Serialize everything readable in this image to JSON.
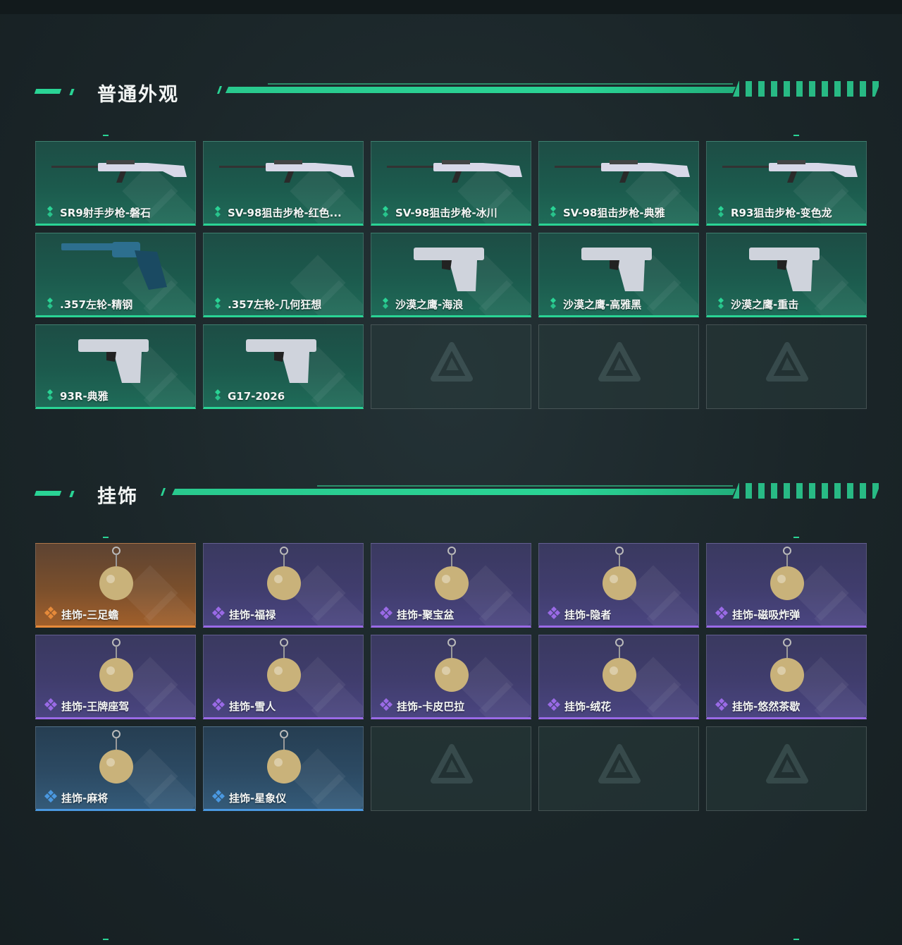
{
  "sections": [
    {
      "title": "普通外观",
      "items": [
        {
          "label": "SR9射手步枪-磐石",
          "rarity": "green",
          "icon": "rifle-icon"
        },
        {
          "label": "SV-98狙击步枪-红色...",
          "rarity": "green",
          "icon": "rifle-icon"
        },
        {
          "label": "SV-98狙击步枪-冰川",
          "rarity": "green",
          "icon": "rifle-icon"
        },
        {
          "label": "SV-98狙击步枪-典雅",
          "rarity": "green",
          "icon": "rifle-icon"
        },
        {
          "label": "R93狙击步枪-变色龙",
          "rarity": "green",
          "icon": "rifle-icon"
        },
        {
          "label": ".357左轮-精钢",
          "rarity": "green",
          "icon": "revolver-icon"
        },
        {
          "label": ".357左轮-几何狂想",
          "rarity": "green",
          "icon": ""
        },
        {
          "label": "沙漠之鹰-海浪",
          "rarity": "green",
          "icon": "pistol-icon"
        },
        {
          "label": "沙漠之鹰-高雅黑",
          "rarity": "green",
          "icon": "pistol-icon"
        },
        {
          "label": "沙漠之鹰-重击",
          "rarity": "green",
          "icon": "pistol-icon"
        },
        {
          "label": "93R-典雅",
          "rarity": "green",
          "icon": "pistol-icon"
        },
        {
          "label": "G17-2026",
          "rarity": "green",
          "icon": "pistol-icon"
        },
        {
          "label": "",
          "rarity": "empty"
        },
        {
          "label": "",
          "rarity": "empty"
        },
        {
          "label": "",
          "rarity": "empty"
        }
      ]
    },
    {
      "title": "挂饰",
      "items": [
        {
          "label": "挂饰-三足蟾",
          "rarity": "orange",
          "icon": "charm-icon"
        },
        {
          "label": "挂饰-福禄",
          "rarity": "purple",
          "icon": "charm-icon"
        },
        {
          "label": "挂饰-聚宝盆",
          "rarity": "purple",
          "icon": "charm-icon"
        },
        {
          "label": "挂饰-隐者",
          "rarity": "purple",
          "icon": "charm-icon"
        },
        {
          "label": "挂饰-磁吸炸弹",
          "rarity": "purple",
          "icon": "charm-icon"
        },
        {
          "label": "挂饰-王牌座驾",
          "rarity": "purple",
          "icon": "charm-icon"
        },
        {
          "label": "挂饰-雪人",
          "rarity": "purple",
          "icon": "charm-icon"
        },
        {
          "label": "挂饰-卡皮巴拉",
          "rarity": "purple",
          "icon": "charm-icon"
        },
        {
          "label": "挂饰-绒花",
          "rarity": "purple",
          "icon": "charm-icon"
        },
        {
          "label": "挂饰-悠然茶歇",
          "rarity": "purple",
          "icon": "charm-icon"
        },
        {
          "label": "挂饰-麻将",
          "rarity": "blue",
          "icon": "charm-icon"
        },
        {
          "label": "挂饰-星象仪",
          "rarity": "blue",
          "icon": "charm-icon"
        },
        {
          "label": "",
          "rarity": "empty"
        },
        {
          "label": "",
          "rarity": "empty"
        },
        {
          "label": "",
          "rarity": "empty"
        }
      ]
    }
  ],
  "colors": {
    "green": "#2ad495",
    "purple": "#9a6ae6",
    "orange": "#e68a3a",
    "blue": "#4a98e0"
  }
}
